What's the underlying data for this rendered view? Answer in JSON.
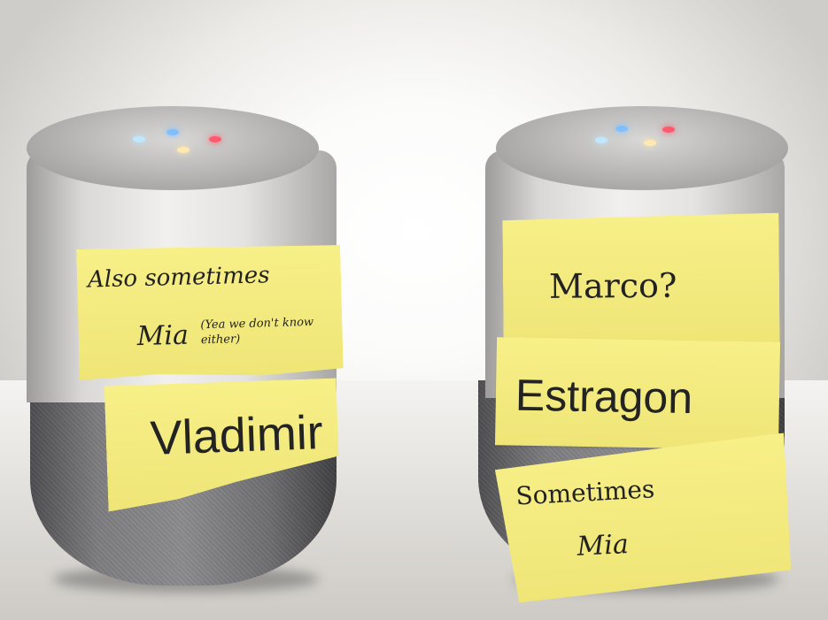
{
  "photo": {
    "left_speaker": {
      "note_top": {
        "line1": "Also sometimes",
        "line2": "Mia",
        "aside": "(Yea we don't know either)"
      },
      "note_bottom": "Vladimir",
      "led_colors": [
        "#b9e7ff",
        "#7fbfff",
        "#ff5a6e",
        "#ffe9b0"
      ]
    },
    "right_speaker": {
      "note_top": "Marco?",
      "note_middle": "Estragon",
      "note_bottom": {
        "line1": "Sometimes",
        "line2": "Mia"
      },
      "led_colors": [
        "#7fbfff",
        "#b9e7ff",
        "#ff5a6e",
        "#ffe9b0"
      ]
    }
  }
}
